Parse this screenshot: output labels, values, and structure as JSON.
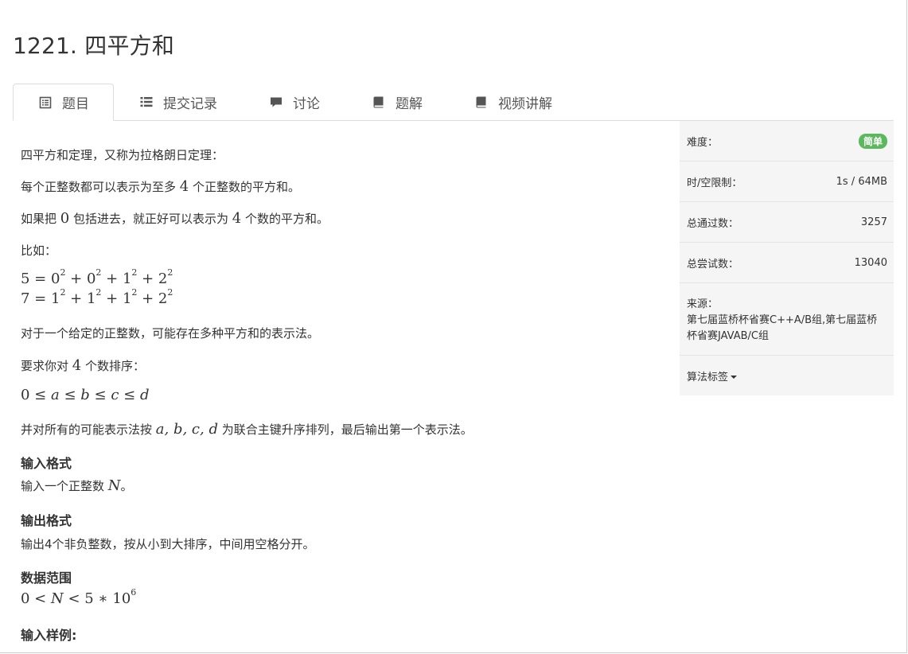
{
  "problem": {
    "title": "1221. 四平方和"
  },
  "tabs": [
    {
      "label": "题目",
      "icon": "list-alt-icon"
    },
    {
      "label": "提交记录",
      "icon": "list-icon"
    },
    {
      "label": "讨论",
      "icon": "comment-icon"
    },
    {
      "label": "题解",
      "icon": "book-icon"
    },
    {
      "label": "视频讲解",
      "icon": "book-icon"
    }
  ],
  "body": {
    "p1": "四平方和定理，又称为拉格朗日定理：",
    "p2_pre": "每个正整数都可以表示为至多 ",
    "p2_num": "4",
    "p2_post": " 个正整数的平方和。",
    "p3_pre": "如果把 ",
    "p3_zero": "0",
    "p3_mid": " 包括进去，就正好可以表示为 ",
    "p3_num": "4",
    "p3_post": " 个数的平方和。",
    "p4": "比如：",
    "p5": "对于一个给定的正整数，可能存在多种平方和的表示法。",
    "p6_pre": "要求你对 ",
    "p6_num": "4",
    "p6_post": " 个数排序：",
    "p7_pre": "并对所有的可能表示法按 ",
    "p7_vars": "a, b, c, d",
    "p7_post": " 为联合主键升序排列，最后输出第一个表示法。",
    "input_heading": "输入格式",
    "input_pre": "输入一个正整数 ",
    "input_var": "N",
    "input_post": "。",
    "output_heading": "输出格式",
    "output_text": "输出4个非负整数，按从小到大排序，中间用空格分开。",
    "range_heading": "数据范围",
    "sample_heading": "输入样例:"
  },
  "sidebar": {
    "difficulty_label": "难度：",
    "difficulty_value": "简单",
    "limit_label": "时/空限制：",
    "limit_value": "1s / 64MB",
    "passed_label": "总通过数：",
    "passed_value": "3257",
    "tried_label": "总尝试数：",
    "tried_value": "13040",
    "source_label": "来源：",
    "source_value": "第七届蓝桥杯省赛C++A/B组,第七届蓝桥杯省赛JAVAB/C组",
    "tags_label": "算法标签"
  },
  "colors": {
    "easy_badge": "#5cb85c"
  }
}
